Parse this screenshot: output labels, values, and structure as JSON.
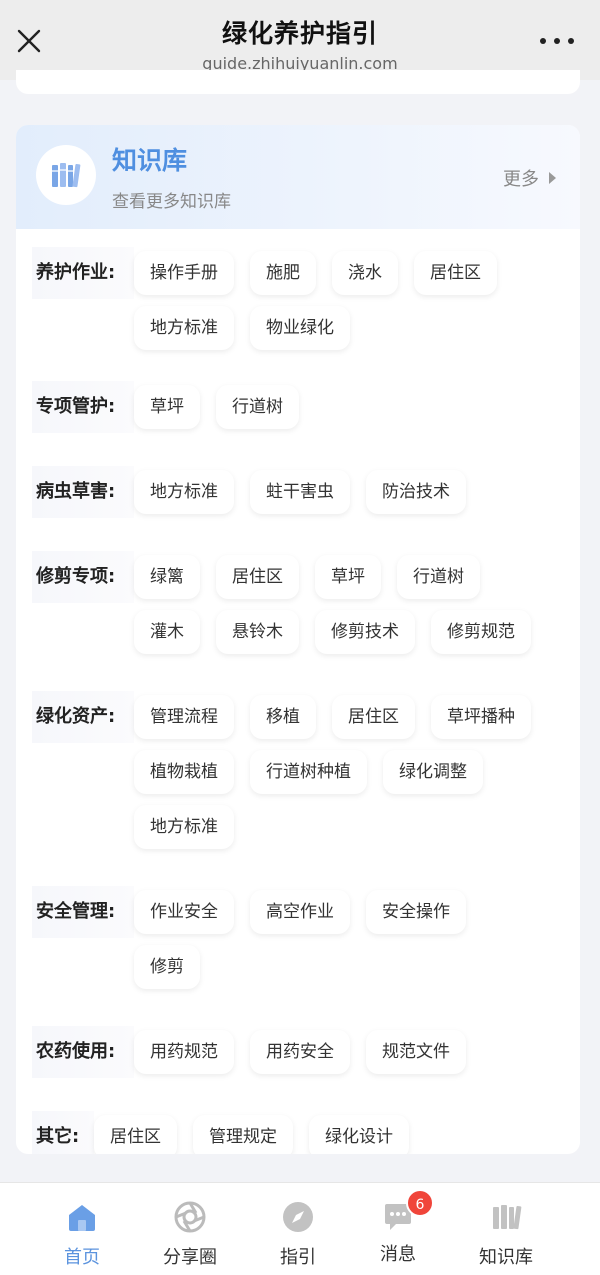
{
  "header": {
    "title": "绿化养护指引",
    "url": "guide.zhihuiyuanlin.com"
  },
  "kb": {
    "title": "知识库",
    "subtitle": "查看更多知识库",
    "more_label": "更多"
  },
  "categories": [
    {
      "label": "养护作业:",
      "tags": [
        "操作手册",
        "施肥",
        "浇水",
        "居住区",
        "地方标准",
        "物业绿化"
      ]
    },
    {
      "label": "专项管护:",
      "tags": [
        "草坪",
        "行道树"
      ]
    },
    {
      "label": "病虫草害:",
      "tags": [
        "地方标准",
        "蛀干害虫",
        "防治技术"
      ]
    },
    {
      "label": "修剪专项:",
      "tags": [
        "绿篱",
        "居住区",
        "草坪",
        "行道树",
        "灌木",
        "悬铃木",
        "修剪技术",
        "修剪规范"
      ]
    },
    {
      "label": "绿化资产:",
      "tags": [
        "管理流程",
        "移植",
        "居住区",
        "草坪播种",
        "植物栽植",
        "行道树种植",
        "绿化调整",
        "地方标准"
      ]
    },
    {
      "label": "安全管理:",
      "tags": [
        "作业安全",
        "高空作业",
        "安全操作",
        "修剪"
      ]
    },
    {
      "label": "农药使用:",
      "tags": [
        "用药规范",
        "用药安全",
        "规范文件"
      ]
    },
    {
      "label": "其它:",
      "tags": [
        "居住区",
        "管理规定",
        "绿化设计"
      ]
    }
  ],
  "nav": {
    "home": "首页",
    "share": "分享圈",
    "guide": "指引",
    "messages": "消息",
    "messages_badge": "6",
    "kb": "知识库",
    "active_color": "#5b93de"
  }
}
